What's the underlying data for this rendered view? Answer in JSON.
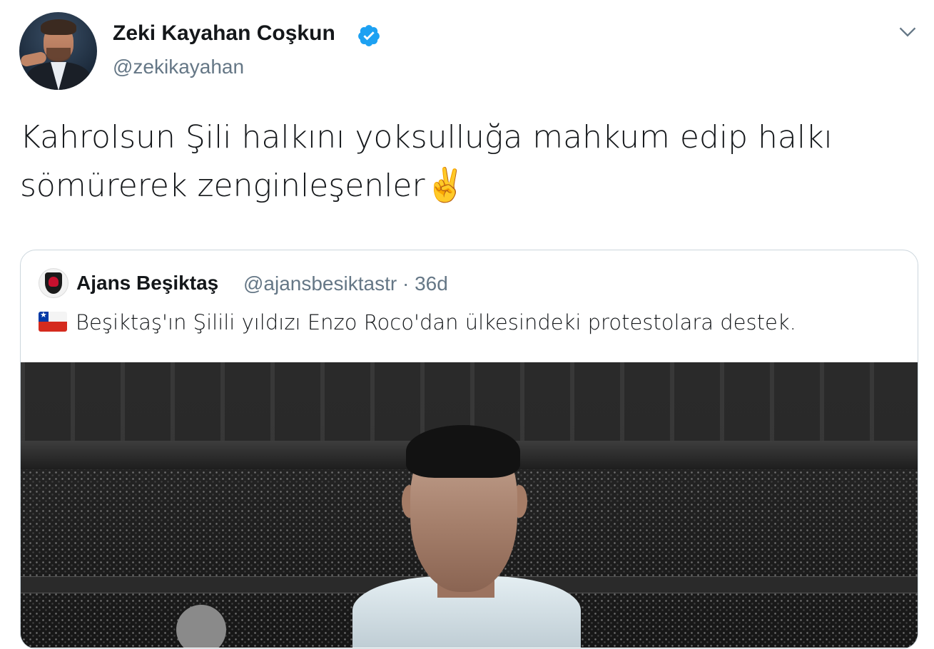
{
  "author": {
    "name": "Zeki Kayahan Coşkun",
    "handle": "@zekikayahan",
    "verified": true,
    "avatar": "profile-photo"
  },
  "menu": {
    "icon": "chevron-down-icon"
  },
  "tweet": {
    "text": "Kahrolsun Şili halkını yoksulluğa mahkum edip halkı sömürerek zenginleşenler",
    "emoji": "✌️"
  },
  "quoted_tweet": {
    "author_name": "Ajans Beşiktaş",
    "meta": "@ajansbesiktastr · 36d",
    "flag_icon": "chile-flag-icon",
    "text": "Beşiktaş'ın Şilili yıldızı Enzo Roco'dan ülkesindeki protestolara destek.",
    "media": "stadium-player-photo"
  },
  "colors": {
    "text": "#14171a",
    "secondary": "#657786",
    "border": "#ccd6dd",
    "verified": "#1da1f2"
  }
}
